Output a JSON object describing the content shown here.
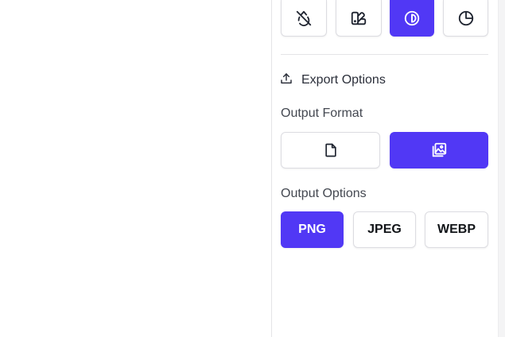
{
  "tool_row": {
    "items": [
      {
        "icon": "drop-off-icon",
        "active": false
      },
      {
        "icon": "palette-swatch-icon",
        "active": false
      },
      {
        "icon": "contrast-icon",
        "active": true
      },
      {
        "icon": "pie-chart-icon",
        "active": false
      }
    ]
  },
  "export": {
    "title": "Export Options",
    "icon": "upload-icon"
  },
  "output_format": {
    "label": "Output Format",
    "options": [
      {
        "icon": "document-icon",
        "active": false
      },
      {
        "icon": "image-gallery-icon",
        "active": true
      }
    ]
  },
  "output_options": {
    "label": "Output Options",
    "options": [
      "PNG",
      "JPEG",
      "WEBP"
    ],
    "selected": "PNG"
  },
  "colors": {
    "accent": "#5138f5",
    "border": "#dcdce1",
    "text": "#2b2f3a"
  }
}
